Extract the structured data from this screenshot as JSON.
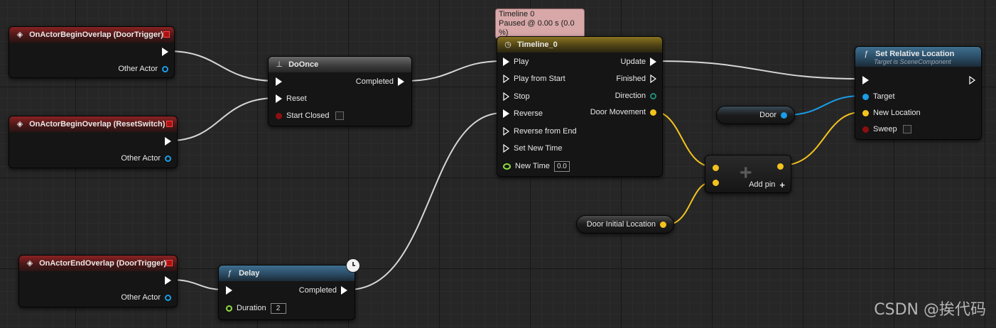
{
  "nodes": {
    "begin_overlap_door": {
      "title": "OnActorBeginOverlap (DoorTrigger)",
      "other_actor": "Other Actor"
    },
    "begin_overlap_reset": {
      "title": "OnActorBeginOverlap (ResetSwitch)",
      "other_actor": "Other Actor"
    },
    "end_overlap_door": {
      "title": "OnActorEndOverlap (DoorTrigger)",
      "other_actor": "Other Actor"
    },
    "do_once": {
      "title": "DoOnce",
      "completed": "Completed",
      "reset": "Reset",
      "start_closed": "Start Closed"
    },
    "delay": {
      "title": "Delay",
      "completed": "Completed",
      "duration_label": "Duration",
      "duration_value": "2"
    },
    "timeline": {
      "title": "Timeline_0",
      "tooltip_line1": "Timeline 0",
      "tooltip_line2": "Paused @ 0.00 s (0.0 %)",
      "inputs": [
        "Play",
        "Play from Start",
        "Stop",
        "Reverse",
        "Reverse from End",
        "Set New Time"
      ],
      "new_time_label": "New Time",
      "new_time_value": "0.0",
      "outputs": [
        "Update",
        "Finished",
        "Direction",
        "Door Movement"
      ]
    },
    "set_relative_location": {
      "title": "Set Relative Location",
      "subtitle": "Target is SceneComponent",
      "target": "Target",
      "new_location": "New Location",
      "sweep": "Sweep"
    },
    "door_var": {
      "label": "Door"
    },
    "door_initial_var": {
      "label": "Door Initial Location"
    },
    "add_node": {
      "add_pin": "Add pin"
    }
  },
  "colors": {
    "exec": "#ffffff",
    "object": "#1a9ce6",
    "vector": "#f3c31d",
    "bool": "#8c0f0f",
    "float": "#8fdf3f",
    "direction": "#1d8c7c"
  },
  "icons": {
    "event": "diamond-icon",
    "macro": "macro-icon",
    "timeline": "clock-icon",
    "function": "function-icon",
    "add": "plus-icon"
  },
  "watermark": "CSDN @挨代码"
}
